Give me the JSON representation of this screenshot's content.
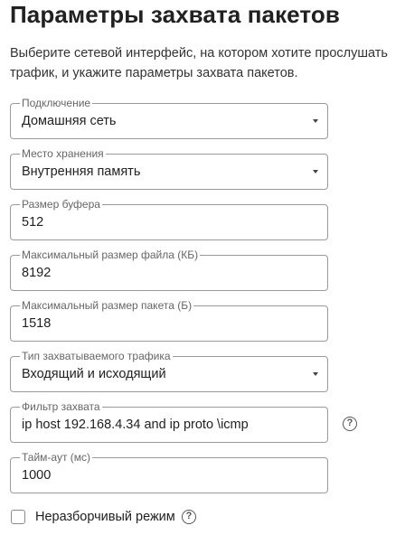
{
  "page": {
    "title": "Параметры захвата пакетов",
    "description": "Выберите сетевой интерфейс, на котором хотите прослушать трафик, и укажите параметры захвата пакетов."
  },
  "fields": {
    "connection": {
      "label": "Подключение",
      "value": "Домашняя сеть",
      "type": "select"
    },
    "storage": {
      "label": "Место хранения",
      "value": "Внутренняя память",
      "type": "select"
    },
    "buffer_size": {
      "label": "Размер буфера",
      "value": "512",
      "type": "input"
    },
    "max_file_size": {
      "label": "Максимальный размер файла (КБ)",
      "value": "8192",
      "type": "input"
    },
    "max_packet_size": {
      "label": "Максимальный размер пакета (Б)",
      "value": "1518",
      "type": "input"
    },
    "traffic_type": {
      "label": "Тип захватываемого трафика",
      "value": "Входящий и исходящий",
      "type": "select"
    },
    "capture_filter": {
      "label": "Фильтр захвата",
      "value": "ip host 192.168.4.34 and ip proto \\icmp",
      "type": "input"
    },
    "timeout": {
      "label": "Тайм-аут (мс)",
      "value": "1000",
      "type": "input"
    }
  },
  "promiscuous": {
    "label": "Неразборчивый режим",
    "checked": false
  },
  "icons": {
    "caret": "dropdown-caret",
    "help": "help-circle",
    "help_glyph": "?"
  },
  "colors": {
    "text": "#212121",
    "border": "#9a9a9a",
    "legend": "#666666"
  }
}
